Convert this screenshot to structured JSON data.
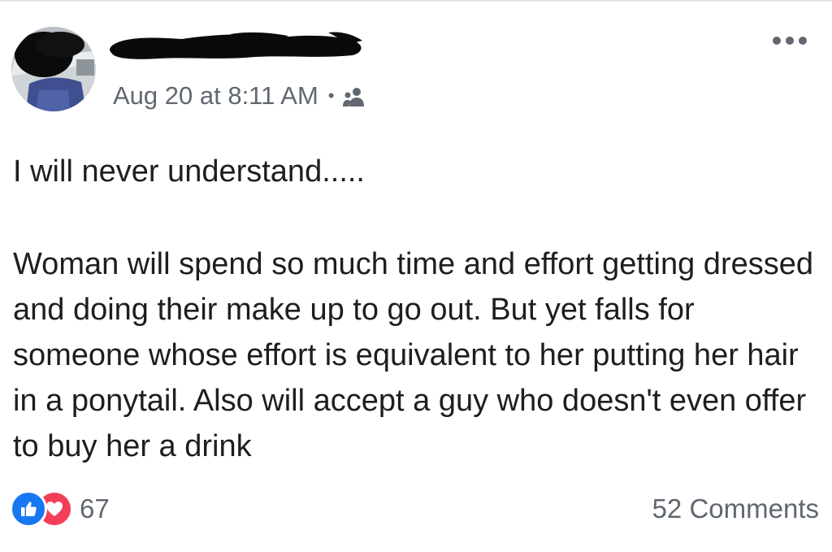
{
  "post": {
    "timestamp": "Aug 20 at 8:11 AM",
    "separator": "•",
    "audience_icon": "friends-icon",
    "more_icon": "more-options-icon",
    "text_paragraphs": [
      "I will never understand.....",
      "Woman will spend so much time and effort getting dressed and doing their make up to go out. But yet falls for someone whose effort is equivalent to her putting her hair in a ponytail. Also will accept a guy who doesn't even offer to buy her a drink"
    ]
  },
  "footer": {
    "reactions": [
      "like-icon",
      "love-icon"
    ],
    "reaction_count": "67",
    "comments_label": "52 Comments"
  },
  "colors": {
    "text": "#1c1e21",
    "secondary_text": "#606770",
    "like_blue": "#1877f2",
    "love_red": "#f33e58"
  }
}
